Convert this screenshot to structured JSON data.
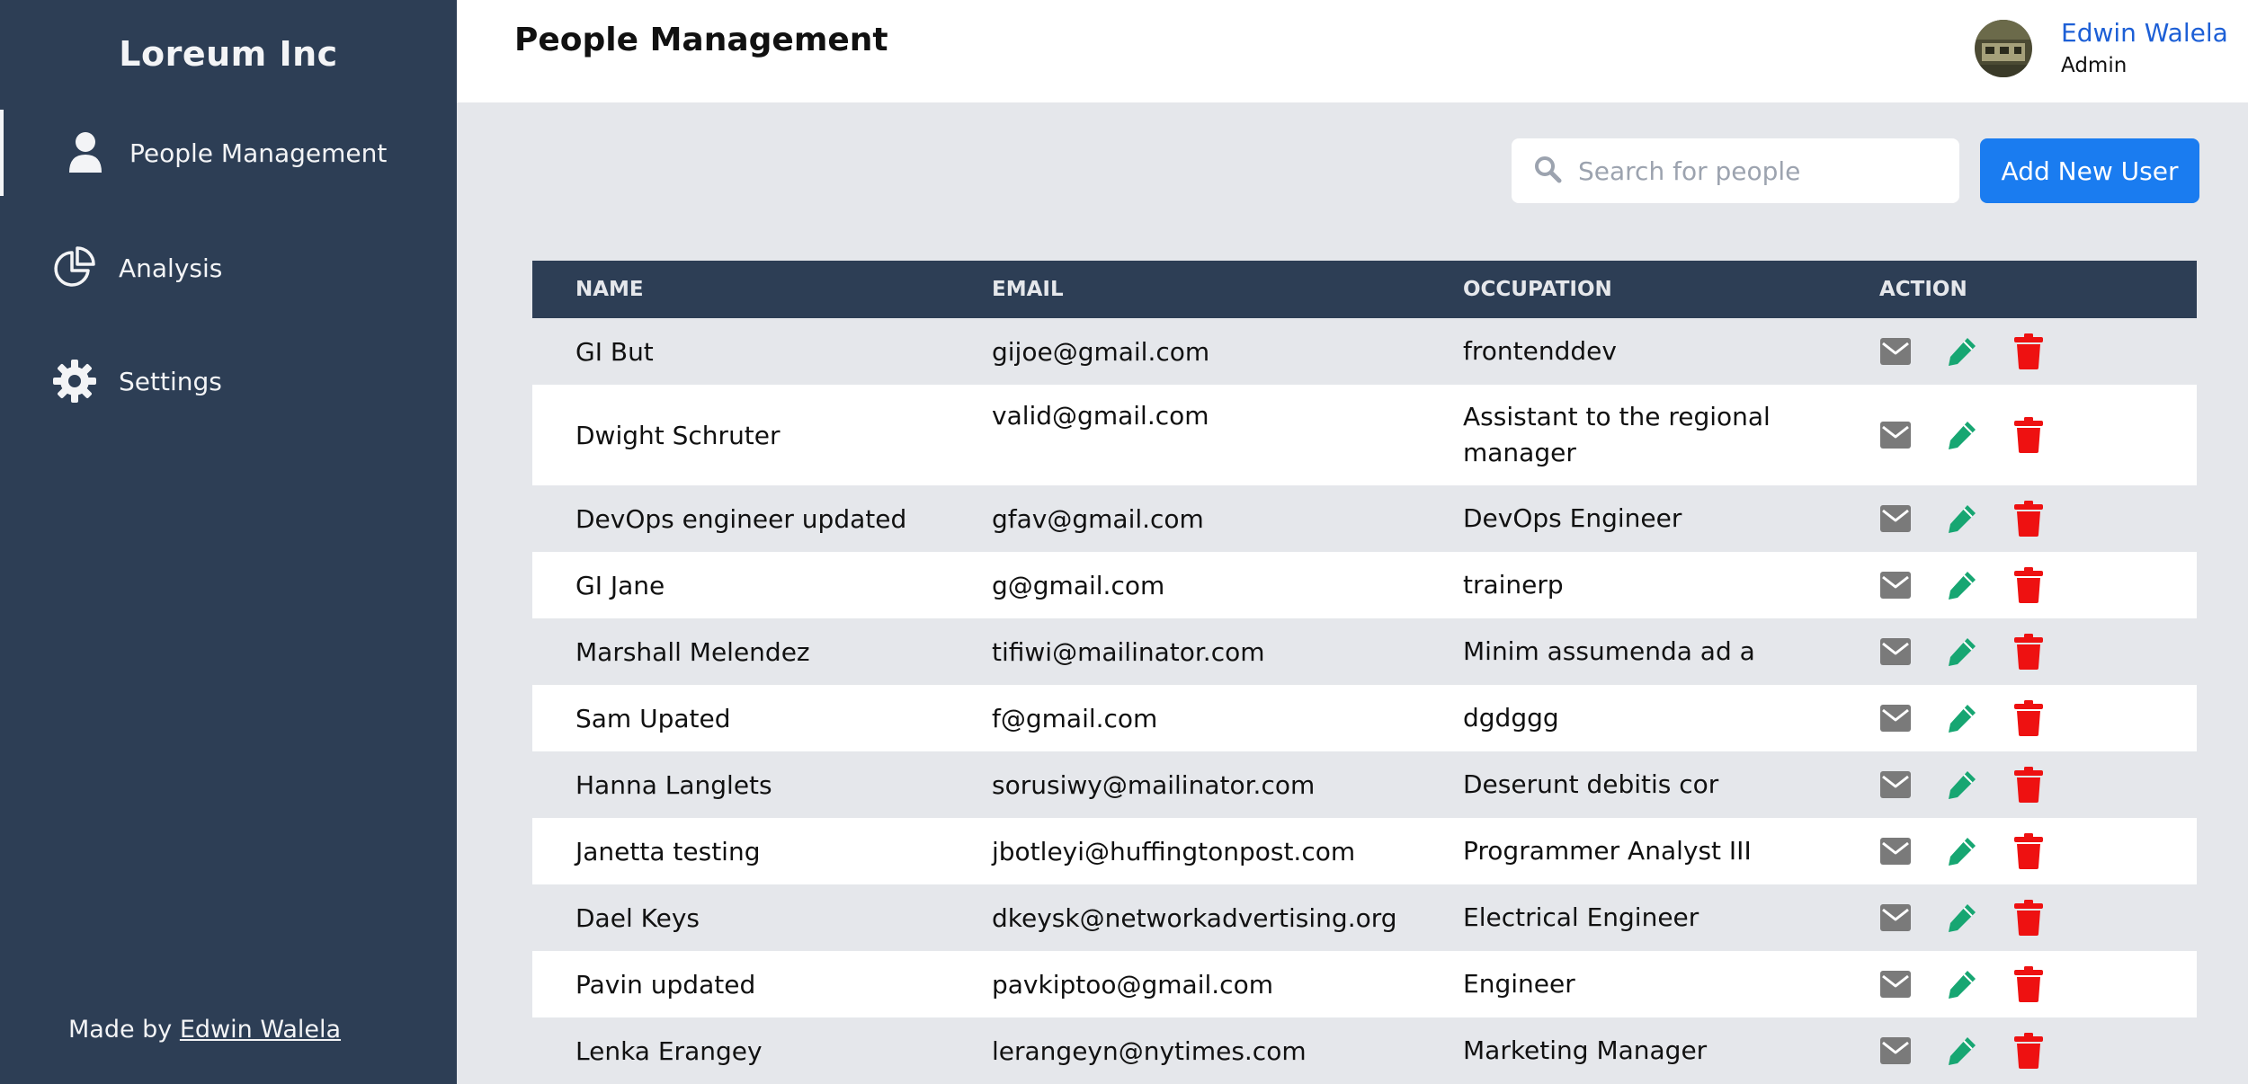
{
  "sidebar": {
    "brand": "Loreum Inc",
    "items": [
      {
        "label": "People Management",
        "icon": "user-icon",
        "active": true
      },
      {
        "label": "Analysis",
        "icon": "pie-chart-icon",
        "active": false
      },
      {
        "label": "Settings",
        "icon": "gear-icon",
        "active": false
      }
    ],
    "footer": {
      "prefix": "Made by ",
      "link": "Edwin Walela"
    }
  },
  "header": {
    "title": "People Management",
    "user": {
      "name": "Edwin Walela",
      "role": "Admin"
    }
  },
  "toolbar": {
    "search_placeholder": "Search for people",
    "add_label": "Add New User"
  },
  "table": {
    "columns": [
      "NAME",
      "EMAIL",
      "OCCUPATION",
      "ACTION"
    ],
    "rows": [
      {
        "name": "GI But",
        "email": "gijoe@gmail.com",
        "occupation": "frontenddev"
      },
      {
        "name": "Dwight Schruter",
        "email": "valid@gmail.com",
        "occupation": "Assistant to the regional manager"
      },
      {
        "name": "DevOps engineer updated",
        "email": "gfav@gmail.com",
        "occupation": "DevOps Engineer"
      },
      {
        "name": "GI Jane",
        "email": "g@gmail.com",
        "occupation": "trainerp"
      },
      {
        "name": "Marshall Melendez",
        "email": "tifiwi@mailinator.com",
        "occupation": "Minim assumenda ad a"
      },
      {
        "name": "Sam Upated",
        "email": "f@gmail.com",
        "occupation": "dgdggg"
      },
      {
        "name": "Hanna Langlets",
        "email": "sorusiwy@mailinator.com",
        "occupation": "Deserunt debitis cor"
      },
      {
        "name": "Janetta testing",
        "email": "jbotleyi@huffingtonpost.com",
        "occupation": "Programmer Analyst III"
      },
      {
        "name": "Dael Keys",
        "email": "dkeysk@networkadvertising.org",
        "occupation": "Electrical Engineer"
      },
      {
        "name": "Pavin updated",
        "email": "pavkiptoo@gmail.com",
        "occupation": "Engineer"
      },
      {
        "name": "Lenka Erangey",
        "email": "lerangeyn@nytimes.com",
        "occupation": "Marketing Manager"
      }
    ]
  },
  "colors": {
    "sidebar_bg": "#2d3e55",
    "accent": "#1a7cf0",
    "mail_icon": "#7a7a7a",
    "edit_icon": "#17a672",
    "delete_icon": "#ee1111"
  }
}
